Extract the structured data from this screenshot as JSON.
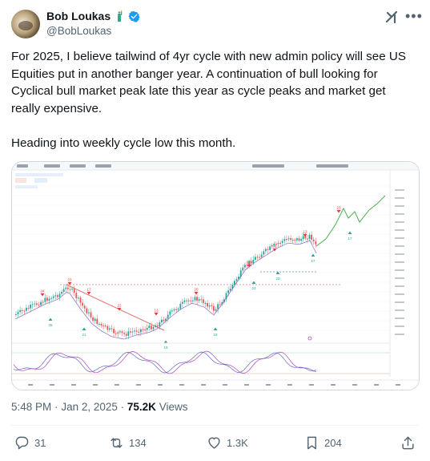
{
  "author": {
    "name": "Bob Loukas",
    "handle": "@BobLoukas",
    "name_emoji_icon": "statue-of-liberty-icon",
    "verified_icon": "verified-badge-icon"
  },
  "header_icons": [
    "grok-icon",
    "more-options-icon"
  ],
  "tweet": {
    "text": "For 2025, I believe tailwind of 4yr cycle with new admin policy will see US Equities put in another banger year. A continuation of bull looking for Cyclical bull market peak late this year as cycle peaks and market get really expensive.\n\nHeading into weekly cycle low this month."
  },
  "media": {
    "chart_labels": [
      "24",
      "25",
      "23",
      "21",
      "17",
      "22",
      "13",
      "19",
      "20",
      "18",
      "15",
      "23",
      "16",
      "22",
      "13",
      "17",
      "23",
      "17"
    ],
    "note": ""
  },
  "meta": {
    "time": "5:48 PM",
    "separator1": "·",
    "date": "Jan 2, 2025",
    "separator2": "·",
    "views_count": "75.2K",
    "views_label": "Views"
  },
  "actions": {
    "replies": "31",
    "reposts": "134",
    "likes": "1.3K",
    "bookmarks": "204"
  },
  "colors": {
    "text": "#0f1419",
    "secondary": "#536471",
    "verified": "#1d9bf0",
    "candle_up": "#26a69a",
    "candle_down": "#ef5350",
    "projection": "#4caf50"
  }
}
